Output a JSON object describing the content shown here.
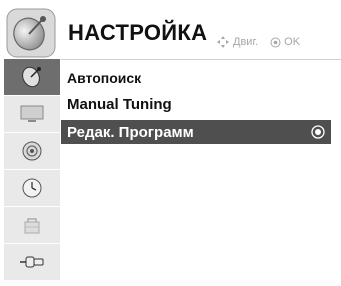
{
  "header": {
    "title": "НАСТРОЙКА",
    "hint_move": "Двиг.",
    "hint_ok": "OK",
    "icon": "satellite-dish-icon"
  },
  "sidebar": {
    "items": [
      {
        "icon": "satellite-dish-icon",
        "active": true
      },
      {
        "icon": "monitor-icon",
        "active": false
      },
      {
        "icon": "speaker-icon",
        "active": false
      },
      {
        "icon": "clock-icon",
        "active": false
      },
      {
        "icon": "lock-icon",
        "active": false
      },
      {
        "icon": "plug-icon",
        "active": false
      }
    ]
  },
  "menu": {
    "items": [
      {
        "label": "Автопоиск",
        "selected": false
      },
      {
        "label": "Manual Tuning",
        "selected": false
      },
      {
        "label": "Редак. Программ",
        "selected": true
      }
    ]
  },
  "colors": {
    "selected_row": "#4f4f4f",
    "active_side": "#6e6e6e",
    "inactive_side": "#e9e9e9",
    "hint_text": "#a6a6a6"
  }
}
